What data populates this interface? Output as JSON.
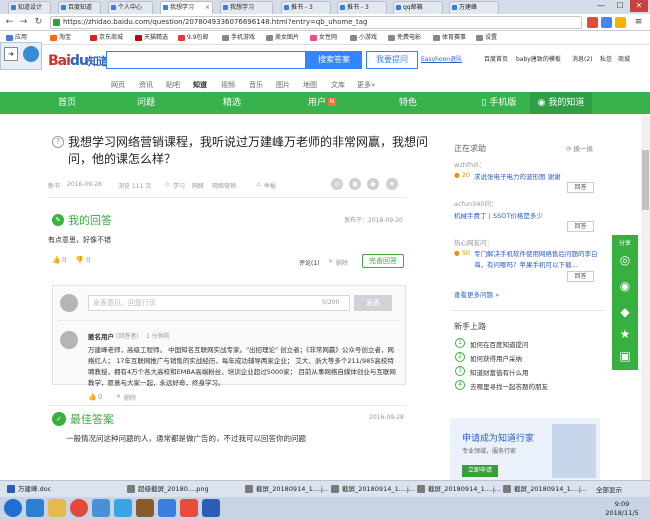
{
  "browser": {
    "tabs": [
      "知道设计",
      "百度知道",
      "个人中心",
      "我想学习",
      "我想学习",
      "推书 - 3",
      "推书 - 3",
      "qq邮箱",
      "万建峰"
    ],
    "url": "https://zhidao.baidu.com/question/2078049336076696148.html?entry=qb_uhome_tag",
    "bookmarks": [
      "应用",
      "淘宝",
      "京东商城",
      "天猫精选",
      "9.9包邮",
      "手机游戏",
      "美女图片",
      "女性网",
      "小游戏",
      "免费电影",
      "体育赛事",
      "设置"
    ],
    "window_controls": [
      "—",
      "☐",
      "✕"
    ]
  },
  "header": {
    "logo_main": "Bai",
    "logo_paw": "du",
    "logo_zhidao": "知道",
    "search_button": "搜索答案",
    "ask_button": "我要提问",
    "user_links": [
      "Easyhoon退队",
      "百度首页",
      "baby唐致的模板",
      "消息(2)",
      "私信",
      "商城"
    ],
    "top_nav": [
      "网页",
      "资讯",
      "贴吧",
      "知道",
      "视频",
      "音乐",
      "图片",
      "地图",
      "文库",
      "更多»"
    ],
    "top_nav_active": "知道"
  },
  "green_nav": {
    "items": [
      "首页",
      "问题",
      "精选",
      "用户",
      "特色",
      "手机版",
      "我的知道"
    ],
    "new_badge": "N"
  },
  "question": {
    "title": "我想学习网络营销课程，我听说过万建峰万老师的非常网赢，我想问问，他的课怎么样？",
    "meta": [
      "新书",
      "2016-09-28",
      "浏览 111 次",
      "学习",
      "网络",
      "网络营销",
      "举报"
    ],
    "action_icons": [
      "wechat-icon",
      "weibo-icon",
      "qq-icon",
      "star-icon"
    ]
  },
  "my_answer": {
    "heading": "我的回答",
    "date": "发布于：2018-09-20",
    "text": "有点意思，好像不错",
    "likes": "0",
    "dislikes": "0",
    "comment_label": "评论(1)",
    "delete_label": "删除",
    "improve_button": "完善回答"
  },
  "comment": {
    "placeholder": "发表意见，回复行页",
    "counter": "0/200",
    "send": "发表",
    "user": "匿名用户",
    "user_tag": "(回答者)",
    "time": "1 分钟前",
    "text": "万建峰老师，高级工程师。 中国知名互联网实战专家。\"出招理论\" 创立者；《非常网赢》公众号创立者，网络红人； 17年互联网推广与销售的实战经历，每年成功辅导两家企业； 艾大、浙大等多个211/985高校特聘教授，拥有4万个各大高校和EMBA高端粉丝，培训企业超过5000家； 目前从事网络自媒体创业与互联网教学，愿意与大家一起，永远好奇，终身学习。",
    "likes": "0",
    "delete": "删除"
  },
  "best_answer": {
    "heading": "最佳答案",
    "date": "2016-09-28",
    "text": "一般情况问这种问题的人，通常都是做广告的，不过我可以回答你的问题"
  },
  "sidebar": {
    "heading": "正在求助",
    "refresh": "换一换",
    "items": [
      {
        "user": "wzhfhill：",
        "reward": "20",
        "text": "求说张电子电力的波形图 谢谢",
        "btn": "回答"
      },
      {
        "user": "acfun340问：",
        "reward": "",
        "text": "机械手费丁丨SSOT价格是多少",
        "btn": "回答"
      },
      {
        "user": "热心网友问：",
        "reward": "50",
        "text": "专门解决手机软件使用网络售后问题的李白海，有问哪吗？苹果手机可以下载...",
        "btn": "回答"
      }
    ],
    "more": "查看更多问题 »",
    "newbie_heading": "新手上路",
    "newbie": [
      "如何在百度知道提问",
      "如何获得用户采纳",
      "知道财富值有什么用",
      "去哪里寻找一起答题的朋友"
    ],
    "promo_title": "申请成为知道行家",
    "promo_sub": "专业领域，服务行家",
    "promo_button": "立即申请",
    "share_label": "分享"
  },
  "taskbar": {
    "docs": [
      "万建峰.doc",
      "超级截屏_20180....png",
      "截屏_20180914_1....j...",
      "截屏_20180914_1....j...",
      "截屏_20180914_1....j...",
      "截屏_20180914_1....j..."
    ],
    "show_all": "全部显示",
    "time": "9:09",
    "date": "2018/11/5"
  },
  "colors": {
    "baidu_blue": "#3385ff",
    "zhidao_green": "#38b03f",
    "nav_green": "#37b24d"
  }
}
